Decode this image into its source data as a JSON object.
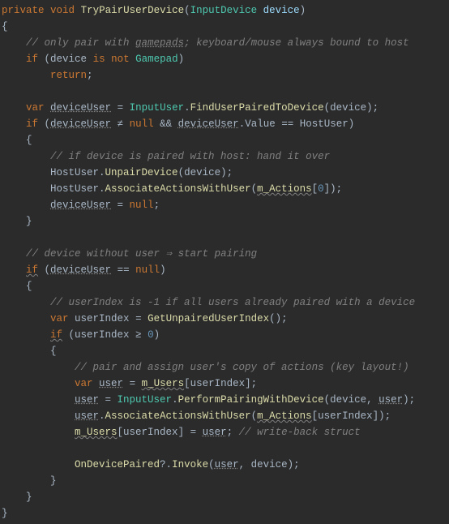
{
  "c": {
    "l1_private": "private",
    "l1_void": "void",
    "l1_name": "TryPairUserDevice",
    "l1_type": "InputDevice",
    "l1_param": "device",
    "l3": "// only pair with ",
    "l3b": "gamepads",
    "l3c": "; keyboard/mouse always bound to host",
    "l4_if": "if",
    "l4_dev": "device",
    "l4_is": "is",
    "l4_not": "not",
    "l4_gp": "Gamepad",
    "l5_return": "return",
    "l7_var": "var",
    "l7_du": "deviceUser",
    "l7_iu": "InputUser",
    "l7_fp": "FindUserPairedToDevice",
    "l7_dev": "device",
    "l8_if": "if",
    "l8_du": "deviceUser",
    "l8_ne": "≠",
    "l8_null": "null",
    "l8_and": "&&",
    "l8_du2": "deviceUser",
    "l8_val": "Value",
    "l8_eq": "==",
    "l8_hu": "HostUser",
    "l10": "// if device is paired with host: hand it over",
    "l11_hu": "HostUser",
    "l11_up": "UnpairDevice",
    "l11_dev": "device",
    "l12_hu": "HostUser",
    "l12_aa": "AssociateActionsWithUser",
    "l12_ma": "m_Actions",
    "l12_z": "0",
    "l13_du": "deviceUser",
    "l13_null": "null",
    "l16": "// device without user ⇒ start pairing",
    "l17_if": "if",
    "l17_du": "deviceUser",
    "l17_eq": "==",
    "l17_null": "null",
    "l19": "// userIndex is -1 if all users already paired with a device",
    "l20_var": "var",
    "l20_ui": "userIndex",
    "l20_gu": "GetUnpairedUserIndex",
    "l21_if": "if",
    "l21_ui": "userIndex",
    "l21_ge": "≥",
    "l21_z": "0",
    "l23": "// pair and assign user's copy of actions (key layout!)",
    "l24_var": "var",
    "l24_user": "user",
    "l24_mu": "m_Users",
    "l24_ui": "userIndex",
    "l25_user": "user",
    "l25_iu": "InputUser",
    "l25_pp": "PerformPairingWithDevice",
    "l25_dev": "device",
    "l25_user2": "user",
    "l26_user": "user",
    "l26_aa": "AssociateActionsWithUser",
    "l26_ma": "m_Actions",
    "l26_ui": "userIndex",
    "l27_mu": "m_Users",
    "l27_ui": "userIndex",
    "l27_user": "user",
    "l27_cm": "// write-back struct",
    "l29_odp": "OnDevicePaired",
    "l29_inv": "Invoke",
    "l29_user": "user",
    "l29_dev": "device"
  }
}
